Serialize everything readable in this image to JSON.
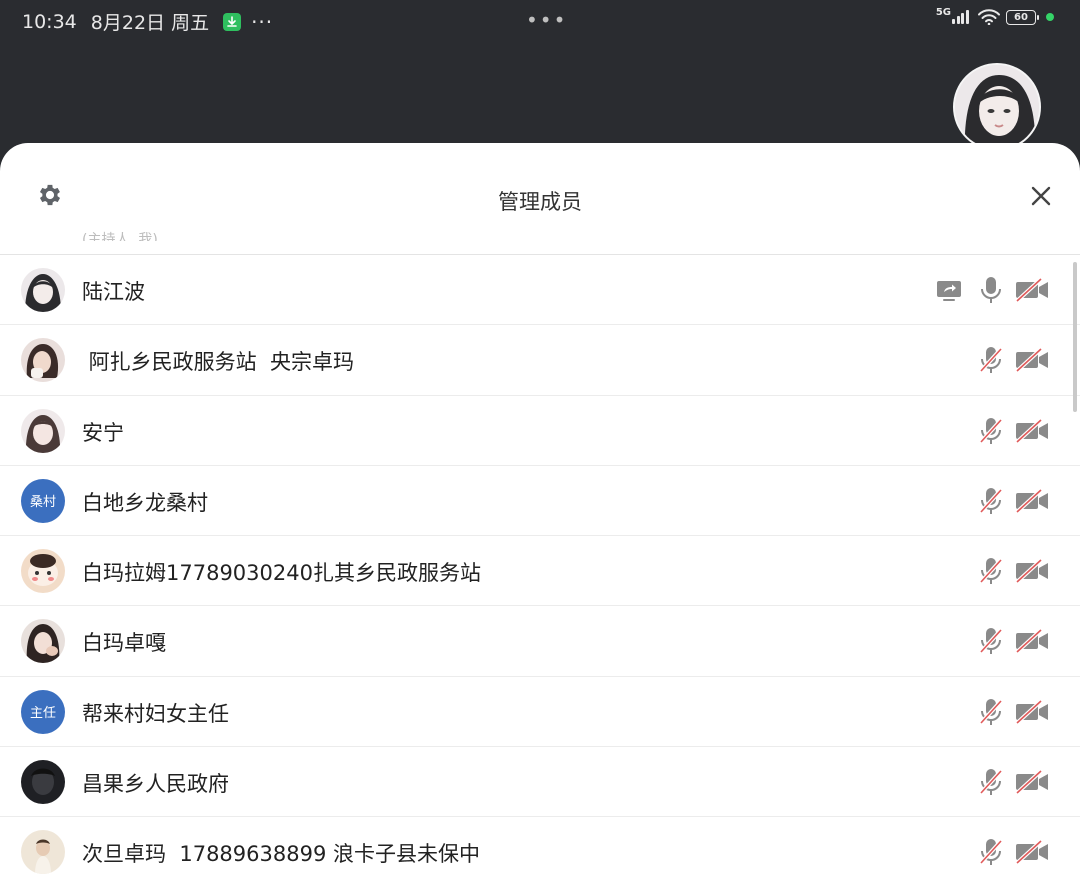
{
  "status_bar": {
    "time": "10:34",
    "date": "8月22日 周五",
    "more": "···",
    "center_dots": "•••",
    "network": "5G",
    "battery": "60"
  },
  "sheet": {
    "title": "管理成员",
    "partial_text": "(主持人, 我)"
  },
  "members": [
    {
      "name": "陆江波",
      "avatar_text": "",
      "can_share": true,
      "mic_muted": false,
      "camera_off": true
    },
    {
      "name": " 阿扎乡民政服务站  央宗卓玛",
      "avatar_text": "",
      "can_share": false,
      "mic_muted": true,
      "camera_off": true
    },
    {
      "name": "安宁",
      "avatar_text": "",
      "can_share": false,
      "mic_muted": true,
      "camera_off": true
    },
    {
      "name": "白地乡龙桑村",
      "avatar_text": "桑村",
      "can_share": false,
      "mic_muted": true,
      "camera_off": true
    },
    {
      "name": "白玛拉姆17789030240扎其乡民政服务站",
      "avatar_text": "",
      "can_share": false,
      "mic_muted": true,
      "camera_off": true
    },
    {
      "name": "白玛卓嘎",
      "avatar_text": "",
      "can_share": false,
      "mic_muted": true,
      "camera_off": true
    },
    {
      "name": "帮来村妇女主任",
      "avatar_text": "主任",
      "can_share": false,
      "mic_muted": true,
      "camera_off": true
    },
    {
      "name": "昌果乡人民政府",
      "avatar_text": "",
      "can_share": false,
      "mic_muted": true,
      "camera_off": true
    },
    {
      "name": "次旦卓玛  17889638899 浪卡子县未保中",
      "avatar_text": "",
      "can_share": false,
      "mic_muted": true,
      "camera_off": true
    }
  ],
  "icons": {
    "settings": "gear-icon",
    "close": "close-icon",
    "share": "screen-share-icon",
    "mic": "microphone-icon",
    "mic_muted": "microphone-muted-icon",
    "camera_off": "camera-off-icon"
  },
  "colors": {
    "header_bg": "#2a2c30",
    "sheet_bg": "#ffffff",
    "text_avatar_bg": "#3b6fbf",
    "muted_slash": "#e05a5a",
    "icon_gray": "#9a9a9a",
    "charging": "#35d468"
  }
}
